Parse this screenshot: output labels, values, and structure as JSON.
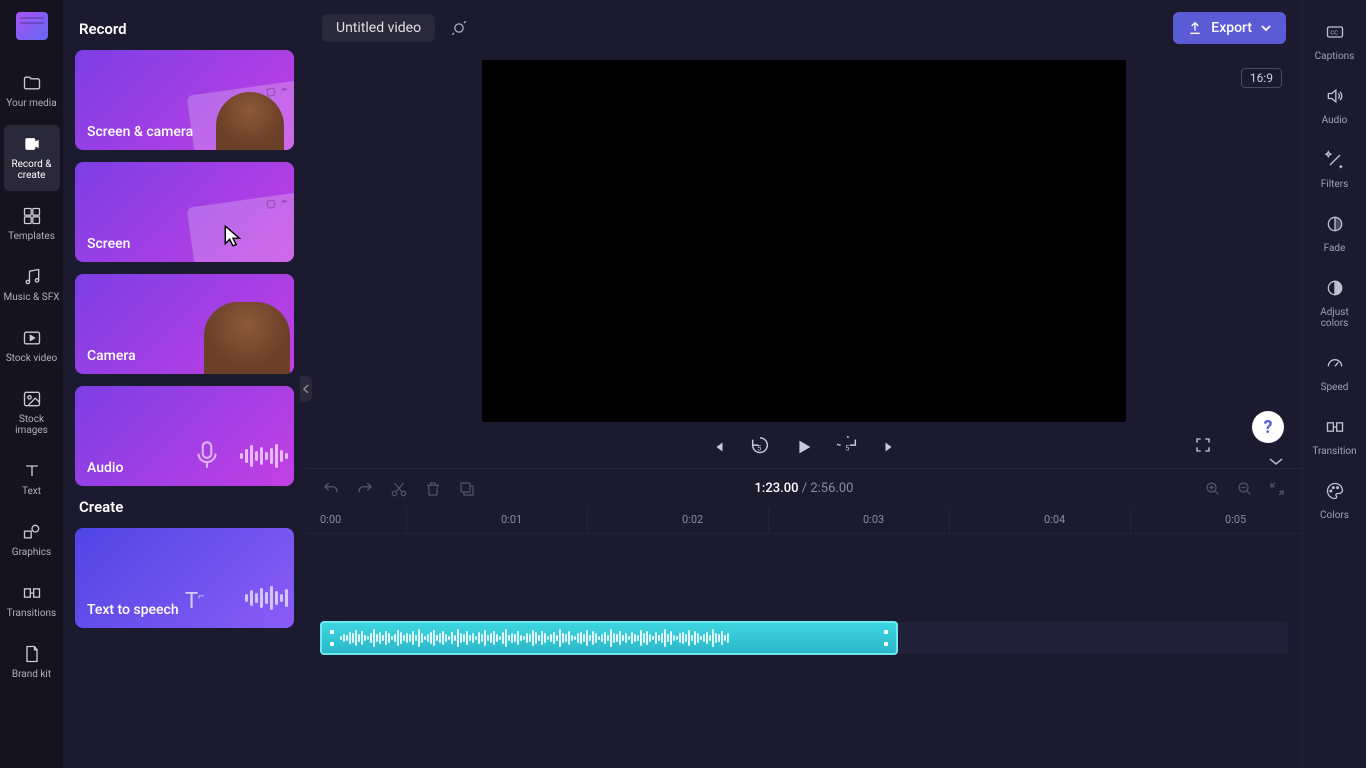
{
  "header": {
    "title": "Untitled video",
    "export_label": "Export",
    "aspect_ratio": "16:9"
  },
  "rail": {
    "items": [
      {
        "label": "Your media",
        "icon": "folder"
      },
      {
        "label": "Record & create",
        "icon": "camera",
        "active": true
      },
      {
        "label": "Templates",
        "icon": "templates"
      },
      {
        "label": "Music & SFX",
        "icon": "music"
      },
      {
        "label": "Stock video",
        "icon": "stockvideo"
      },
      {
        "label": "Stock images",
        "icon": "image"
      },
      {
        "label": "Text",
        "icon": "text"
      },
      {
        "label": "Graphics",
        "icon": "graphics"
      },
      {
        "label": "Transitions",
        "icon": "transitions"
      },
      {
        "label": "Brand kit",
        "icon": "brandkit"
      }
    ]
  },
  "panel": {
    "heading_record": "Record",
    "heading_create": "Create",
    "cards": {
      "screen_camera": "Screen & camera",
      "screen": "Screen",
      "camera": "Camera",
      "audio": "Audio",
      "tts": "Text to speech"
    }
  },
  "time": {
    "current": "1:23.00",
    "duration": "2:56.00"
  },
  "ruler_labels": [
    "0:00",
    "0:01",
    "0:02",
    "0:03",
    "0:04",
    "0:05"
  ],
  "right_rail": {
    "items": [
      {
        "label": "Captions",
        "icon": "cc"
      },
      {
        "label": "Audio",
        "icon": "speaker"
      },
      {
        "label": "Filters",
        "icon": "wand"
      },
      {
        "label": "Fade",
        "icon": "fade"
      },
      {
        "label": "Adjust colors",
        "icon": "contrast"
      },
      {
        "label": "Speed",
        "icon": "speed"
      },
      {
        "label": "Transition",
        "icon": "transition"
      },
      {
        "label": "Colors",
        "icon": "palette"
      }
    ]
  }
}
